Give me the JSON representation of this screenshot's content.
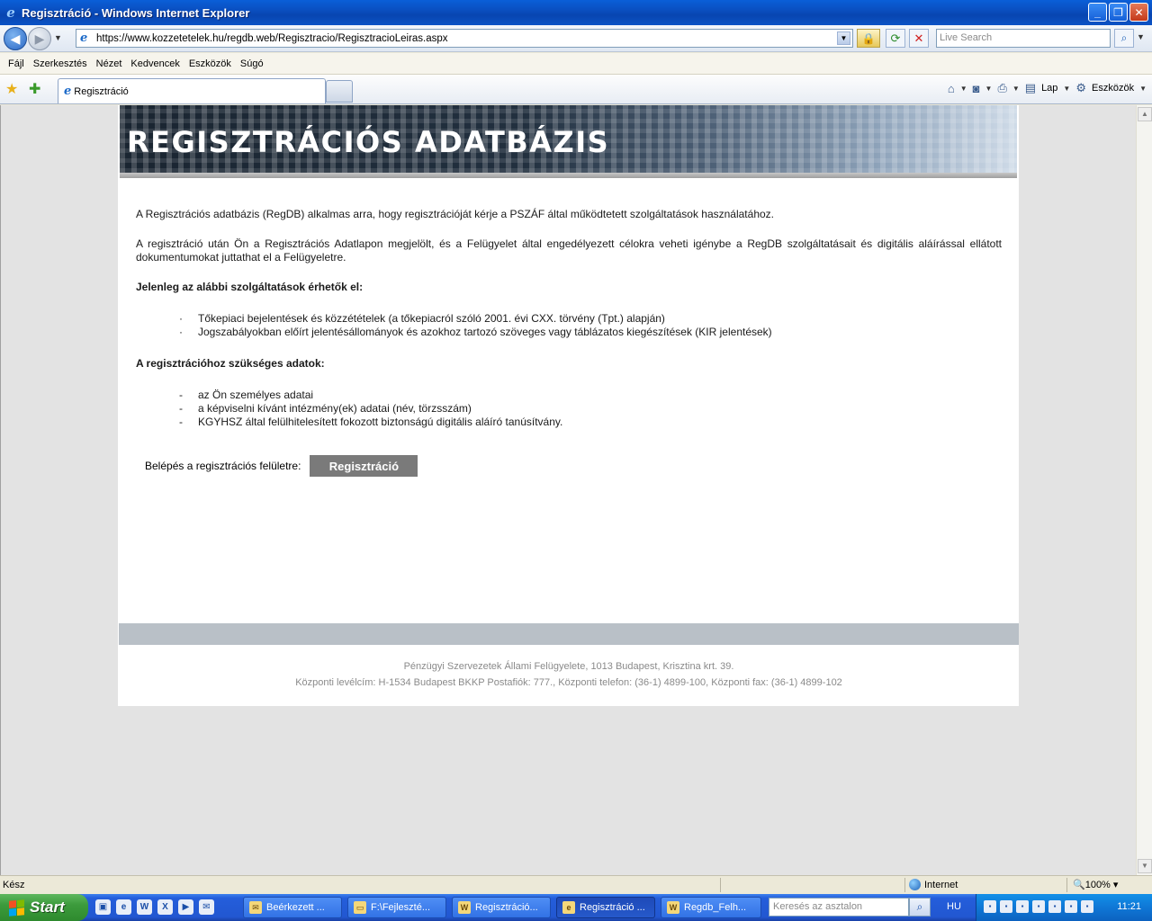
{
  "window": {
    "title": "Regisztráció - Windows Internet Explorer",
    "minimize": "_",
    "restore": "❐",
    "close": "✕"
  },
  "address": {
    "url": "https://www.kozzetetelek.hu/regdb.web/Regisztracio/RegisztracioLeiras.aspx",
    "search_placeholder": "Live Search"
  },
  "menu": [
    "Fájl",
    "Szerkesztés",
    "Nézet",
    "Kedvencek",
    "Eszközök",
    "Súgó"
  ],
  "tab": {
    "label": "Regisztráció"
  },
  "commandbar": {
    "page": "Lap",
    "tools": "Eszközök"
  },
  "page": {
    "banner_title": "REGISZTRÁCIÓS ADATBÁZIS",
    "intro1": "A Regisztrációs adatbázis (RegDB) alkalmas arra, hogy regisztrációját kérje a PSZÁF által működtetett szolgáltatások használatához.",
    "intro2": "A regisztráció után Ön a Regisztrációs Adatlapon megjelölt, és a Felügyelet által engedélyezett célokra veheti igénybe a RegDB szolgáltatásait és digitális aláírással ellátott dokumentumokat juttathat el a Felügyeletre.",
    "services_heading": "Jelenleg az alábbi szolgáltatások érhetők el:",
    "services": [
      "Tőkepiaci bejelentések és közzétételek (a tőkepiacról szóló 2001. évi CXX. törvény (Tpt.) alapján)",
      "Jogszabályokban előírt jelentésállományok és azokhoz tartozó szöveges vagy táblázatos kiegészítések (KIR jelentések)"
    ],
    "required_heading": "A regisztrációhoz szükséges adatok:",
    "required": [
      "az Ön személyes adatai",
      "a képviselni kívánt intézmény(ek) adatai (név, törzsszám)",
      "KGYHSZ által felülhitelesített fokozott biztonságú digitális aláíró tanúsítvány."
    ],
    "login_label": "Belépés a regisztrációs felületre:",
    "register_button": "Regisztráció",
    "footer1": "Pénzügyi Szervezetek Állami Felügyelete, 1013 Budapest, Krisztina krt. 39.",
    "footer2": "Központi levélcím: H-1534 Budapest BKKP Postafiók: 777., Központi telefon: (36-1) 4899-100, Központi fax: (36-1) 4899-102"
  },
  "status": {
    "text": "Kész",
    "zone": "Internet",
    "zoom": "100%"
  },
  "taskbar": {
    "start": "Start",
    "items": [
      "Beérkezett ...",
      "F:\\Fejleszté...",
      "Regisztráció...",
      "Regisztráció ...",
      "Regdb_Felh..."
    ],
    "search_placeholder": "Keresés az asztalon",
    "lang": "HU",
    "clock": "11:21"
  },
  "colors": {
    "titlebar": "#0a4fc0",
    "register_button": "#7a7a7a",
    "footer_bar": "#b9c0c7"
  }
}
